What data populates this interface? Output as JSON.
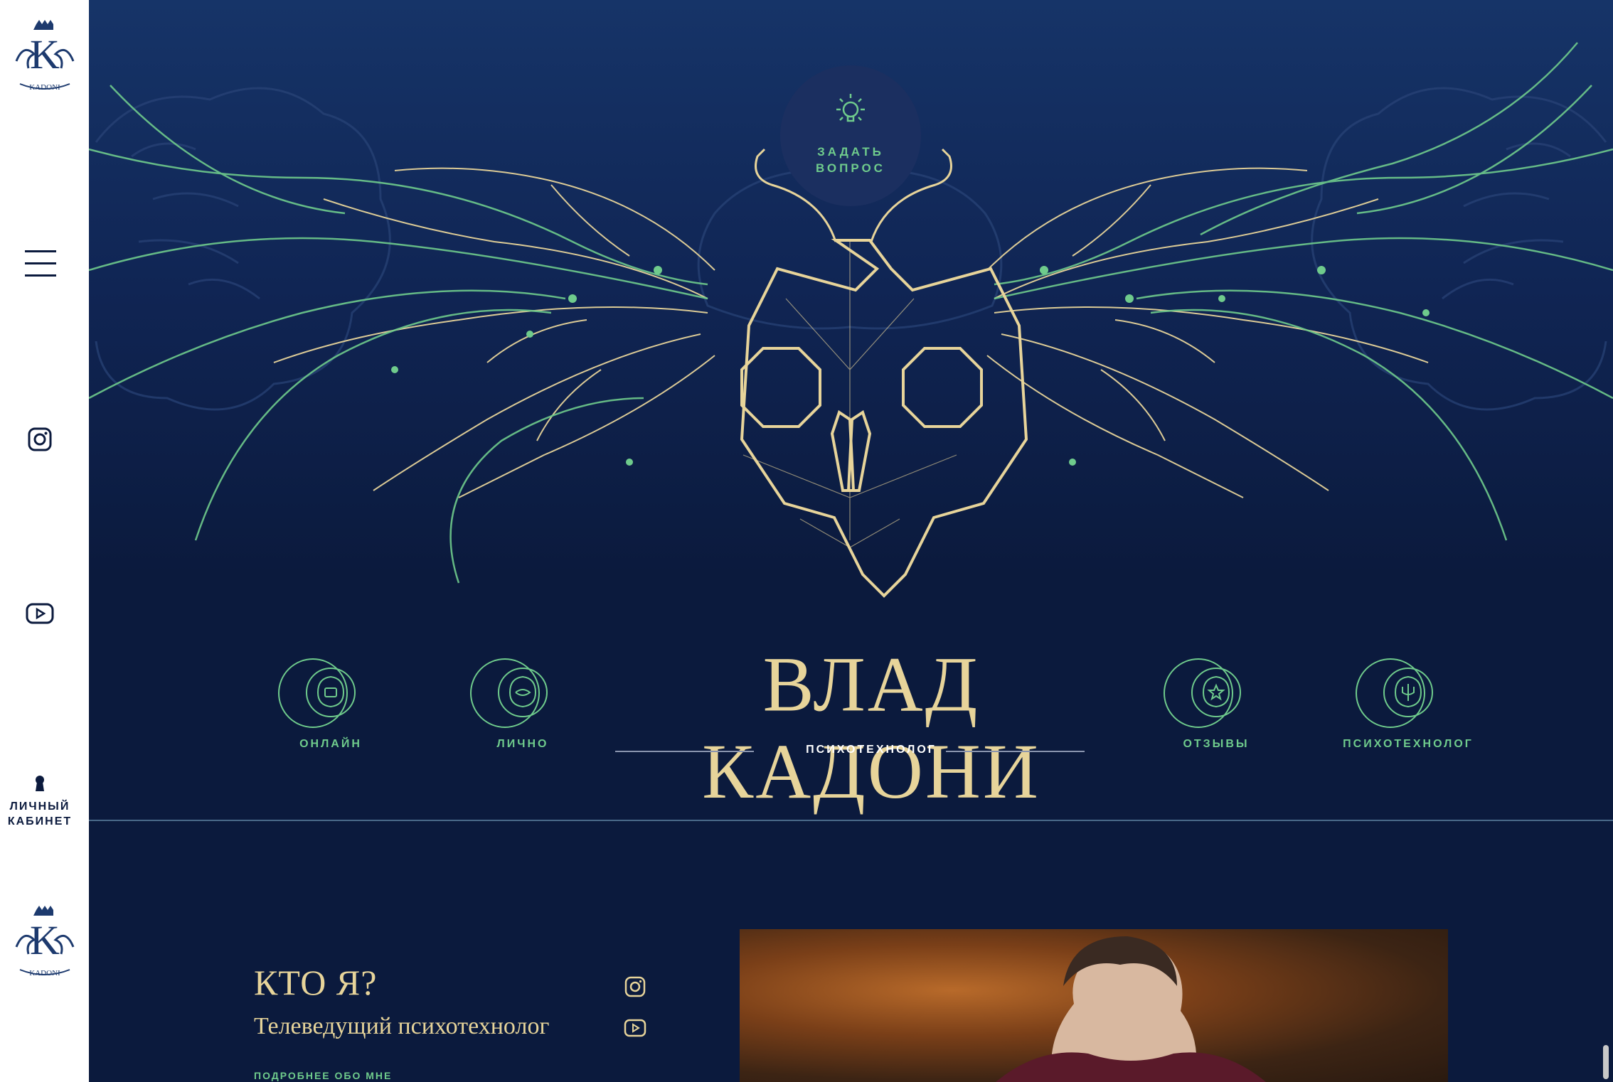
{
  "sidebar": {
    "cabinet_label_line1": "ЛИЧНЫЙ",
    "cabinet_label_line2": "КАБИНЕТ",
    "logo_text": "KADONI"
  },
  "hero": {
    "ask_line1": "ЗАДАТЬ",
    "ask_line2": "ВОПРОС",
    "title": "ВЛАД КАДОНИ",
    "subtitle": "ПСИХОТЕХНОЛОГ",
    "nav": [
      {
        "label": "ОНЛАЙН",
        "icon": "brain-play-icon"
      },
      {
        "label": "ЛИЧНО",
        "icon": "brain-eye-icon"
      },
      {
        "label": "ОТЗЫВЫ",
        "icon": "brain-star-icon"
      },
      {
        "label": "ПСИХОТЕХНОЛОГ",
        "icon": "brain-trident-icon"
      }
    ]
  },
  "about": {
    "title": "КТО Я?",
    "subtitle": "Телеведущий психотехнолог",
    "more": "ПОДРОБНЕЕ ОБО МНЕ"
  },
  "colors": {
    "background": "#0b1a3d",
    "gold": "#e7d49a",
    "green": "#6fcb8c",
    "sidebar": "#ffffff"
  }
}
